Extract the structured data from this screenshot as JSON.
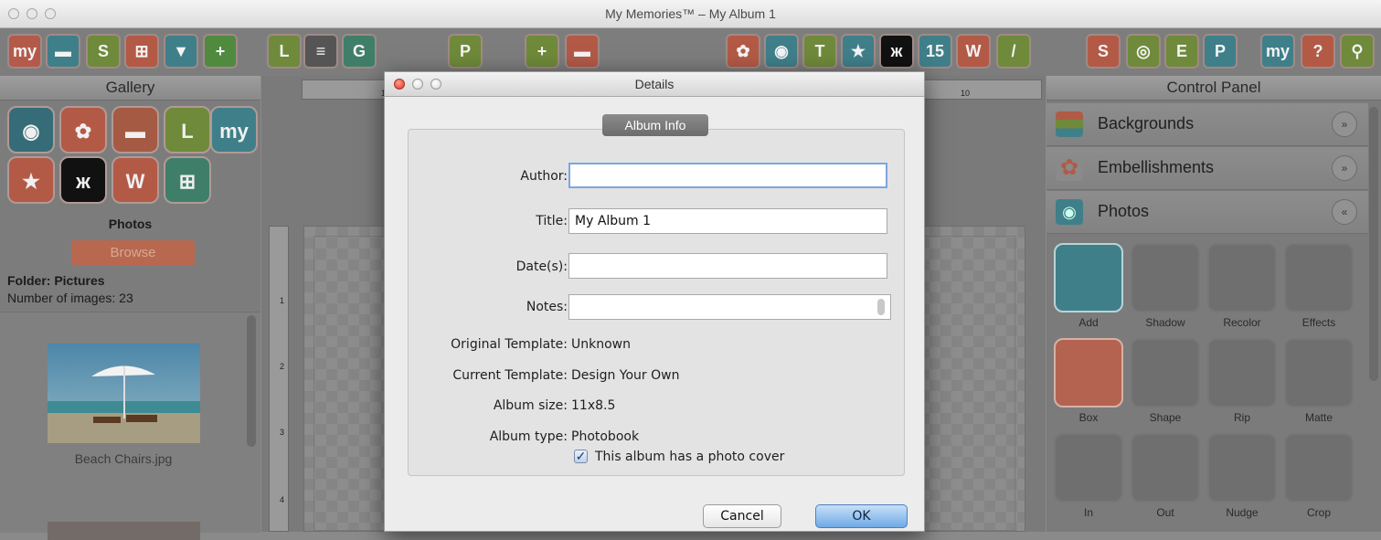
{
  "window": {
    "title": "My Memories™ – My Album 1"
  },
  "toolbar": {
    "icons": [
      {
        "name": "mymemories-logo-icon",
        "glyph": "my",
        "color": "#b45a4a"
      },
      {
        "name": "folder-icon",
        "glyph": "▬",
        "color": "#3f7f8a"
      },
      {
        "name": "save-icon",
        "glyph": "S",
        "color": "#6f8a3a"
      },
      {
        "name": "layout-icon",
        "glyph": "⊞",
        "color": "#b35a47"
      },
      {
        "name": "download-icon",
        "glyph": "▼",
        "color": "#3f7f8a"
      },
      {
        "name": "add-page-icon",
        "glyph": "+",
        "color": "#4f8a3f"
      },
      {
        "name": "layer-L-icon",
        "glyph": "L",
        "color": "#6f8a3a"
      },
      {
        "name": "ruler-icon",
        "glyph": "≡",
        "color": "#555"
      },
      {
        "name": "grid-icon",
        "glyph": "G",
        "color": "#3f7f6a"
      },
      {
        "name": "print-icon",
        "glyph": "P",
        "color": "#6f8a3a"
      },
      {
        "name": "plus-box-icon",
        "glyph": "+",
        "color": "#6f8a3a"
      },
      {
        "name": "backgrounds-icon",
        "glyph": "▬",
        "color": "#b35a47"
      },
      {
        "name": "embellishments-icon",
        "glyph": "✿",
        "color": "#b35a47"
      },
      {
        "name": "camera-icon",
        "glyph": "◉",
        "color": "#3f7f8a"
      },
      {
        "name": "text-icon",
        "glyph": "T",
        "color": "#6f8a3a"
      },
      {
        "name": "star-icon",
        "glyph": "★",
        "color": "#3f7f8a"
      },
      {
        "name": "butterfly-icon",
        "glyph": "ж",
        "color": "#111"
      },
      {
        "name": "calendar-icon",
        "glyph": "15",
        "color": "#3f7f8a"
      },
      {
        "name": "wordart-icon",
        "glyph": "W",
        "color": "#b35a47"
      },
      {
        "name": "brush-icon",
        "glyph": "/",
        "color": "#6f8a3a"
      },
      {
        "name": "spell-icon",
        "glyph": "S",
        "color": "#b35a47"
      },
      {
        "name": "video-icon",
        "glyph": "◎",
        "color": "#6f8a3a"
      },
      {
        "name": "export-icon",
        "glyph": "E",
        "color": "#6f8a3a"
      },
      {
        "name": "pdf-icon",
        "glyph": "P",
        "color": "#3f7f8a"
      },
      {
        "name": "mycom-icon",
        "glyph": "my",
        "color": "#3f7f8a"
      },
      {
        "name": "help-icon",
        "glyph": "?",
        "color": "#b35a47"
      },
      {
        "name": "search-icon",
        "glyph": "⚲",
        "color": "#6f8a3a"
      }
    ]
  },
  "gallery": {
    "title": "Gallery",
    "section_title": "Photos",
    "browse_label": "Browse",
    "folder": "Folder: Pictures",
    "count": "Number of images: 23",
    "thumb_name": "Beach Chairs.jpg",
    "icons": [
      {
        "name": "camera-icon",
        "glyph": "◉",
        "color": "#356c78"
      },
      {
        "name": "embellishments-icon",
        "glyph": "✿",
        "color": "#b35a47"
      },
      {
        "name": "backgrounds-icon",
        "glyph": "▬",
        "color": "#a55a44"
      },
      {
        "name": "layer-L-icon",
        "glyph": "L",
        "color": "#6f8a3a"
      },
      {
        "name": "mycom-icon",
        "glyph": "my",
        "color": "#3f7f8a"
      },
      {
        "name": "star-icon",
        "glyph": "★",
        "color": "#b35a47"
      },
      {
        "name": "butterfly-icon",
        "glyph": "ж",
        "color": "#111"
      },
      {
        "name": "wordart-icon",
        "glyph": "W",
        "color": "#b35a47"
      },
      {
        "name": "layout-icon",
        "glyph": "⊞",
        "color": "#3f7f6a"
      }
    ]
  },
  "ruler": {
    "h_ticks": [
      "1",
      "10"
    ],
    "v_ticks": [
      "1",
      "2",
      "3",
      "4"
    ]
  },
  "control_panel": {
    "title": "Control Panel",
    "sections": [
      {
        "label": "Backgrounds",
        "chev": "»"
      },
      {
        "label": "Embellishments",
        "chev": "»"
      },
      {
        "label": "Photos",
        "chev": "«"
      }
    ],
    "tools": [
      "Add",
      "Shadow",
      "Recolor",
      "Effects",
      "Box",
      "Shape",
      "Rip",
      "Matte",
      "In",
      "Out",
      "Nudge",
      "Crop"
    ]
  },
  "dialog": {
    "title": "Details",
    "group_title": "Album Info",
    "author_label": "Author:",
    "author_value": "",
    "title_label": "Title:",
    "title_value": "My Album 1",
    "dates_label": "Date(s):",
    "dates_value": "",
    "notes_label": "Notes:",
    "notes_value": "",
    "orig_label": "Original Template:",
    "orig_value": "Unknown",
    "curr_label": "Current Template:",
    "curr_value": "Design Your Own",
    "size_label": "Album size:",
    "size_value": "11x8.5",
    "type_label": "Album type:",
    "type_value": "Photobook",
    "cover_label": "This album has a photo cover",
    "cover_checked": true,
    "cancel_label": "Cancel",
    "ok_label": "OK"
  }
}
